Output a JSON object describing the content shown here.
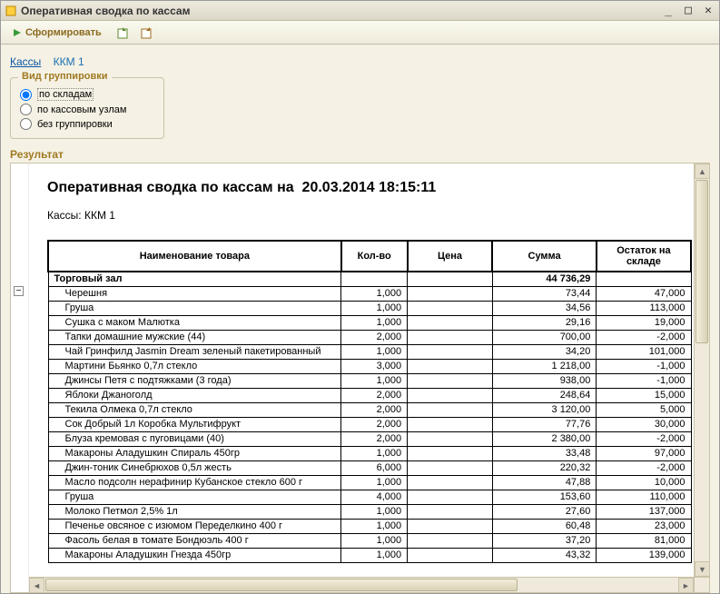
{
  "window": {
    "title": "Оперативная сводка по кассам"
  },
  "toolbar": {
    "form_button": "Сформировать"
  },
  "breadcrumb": {
    "link": "Кассы",
    "current": "ККМ 1"
  },
  "groupbox": {
    "legend": "Вид группировки",
    "options": {
      "by_warehouse": "по складам",
      "by_register": "по кассовым узлам",
      "none": "без группировки"
    },
    "selected": "by_warehouse"
  },
  "result_label": "Результат",
  "report": {
    "title_prefix": "Оперативная сводка по кассам на",
    "date": "20.03.2014 18:15:11",
    "sub": "Кассы: ККМ 1",
    "headers": {
      "name": "Наименование товара",
      "qty": "Кол-во",
      "price": "Цена",
      "sum": "Сумма",
      "stock": "Остаток на складе"
    },
    "group": {
      "name": "Торговый зал",
      "sum": "44 736,29"
    },
    "rows": [
      {
        "name": "Черешня",
        "qty": "1,000",
        "price": "",
        "sum": "73,44",
        "stock": "47,000"
      },
      {
        "name": "Груша",
        "qty": "1,000",
        "price": "",
        "sum": "34,56",
        "stock": "113,000"
      },
      {
        "name": "Сушка с маком Малютка",
        "qty": "1,000",
        "price": "",
        "sum": "29,16",
        "stock": "19,000"
      },
      {
        "name": "Тапки домашние мужские  (44)",
        "qty": "2,000",
        "price": "",
        "sum": "700,00",
        "stock": "-2,000"
      },
      {
        "name": "Чай Гринфилд Jasmin Dream зеленый пакетированный",
        "qty": "1,000",
        "price": "",
        "sum": "34,20",
        "stock": "101,000"
      },
      {
        "name": "Мартини Бьянко 0,7л стекло",
        "qty": "3,000",
        "price": "",
        "sum": "1 218,00",
        "stock": "-1,000"
      },
      {
        "name": "Джинсы Петя с подтяжками (3 года)",
        "qty": "1,000",
        "price": "",
        "sum": "938,00",
        "stock": "-1,000"
      },
      {
        "name": "Яблоки Джаноголд",
        "qty": "2,000",
        "price": "",
        "sum": "248,64",
        "stock": "15,000"
      },
      {
        "name": "Текила Олмека 0,7л стекло",
        "qty": "2,000",
        "price": "",
        "sum": "3 120,00",
        "stock": "5,000"
      },
      {
        "name": "Сок Добрый 1л Коробка Мультифрукт",
        "qty": "2,000",
        "price": "",
        "sum": "77,76",
        "stock": "30,000"
      },
      {
        "name": "Блуза кремовая с пуговицами (40)",
        "qty": "2,000",
        "price": "",
        "sum": "2 380,00",
        "stock": "-2,000"
      },
      {
        "name": "Макароны Аладушкин Спираль 450гр",
        "qty": "1,000",
        "price": "",
        "sum": "33,48",
        "stock": "97,000"
      },
      {
        "name": "Джин-тоник Синебрюхов 0,5л жесть",
        "qty": "6,000",
        "price": "",
        "sum": "220,32",
        "stock": "-2,000"
      },
      {
        "name": "Масло подсолн нерафинир Кубанское стекло 600 г",
        "qty": "1,000",
        "price": "",
        "sum": "47,88",
        "stock": "10,000"
      },
      {
        "name": "Груша",
        "qty": "4,000",
        "price": "",
        "sum": "153,60",
        "stock": "110,000"
      },
      {
        "name": "Молоко Петмол 2,5% 1л",
        "qty": "1,000",
        "price": "",
        "sum": "27,60",
        "stock": "137,000"
      },
      {
        "name": "Печенье овсяное с изюмом Переделкино 400 г",
        "qty": "1,000",
        "price": "",
        "sum": "60,48",
        "stock": "23,000"
      },
      {
        "name": "Фасоль белая в томате Бондюэль 400 г",
        "qty": "1,000",
        "price": "",
        "sum": "37,20",
        "stock": "81,000"
      },
      {
        "name": "Макароны Аладушкин Гнезда 450гр",
        "qty": "1,000",
        "price": "",
        "sum": "43,32",
        "stock": "139,000"
      }
    ]
  }
}
